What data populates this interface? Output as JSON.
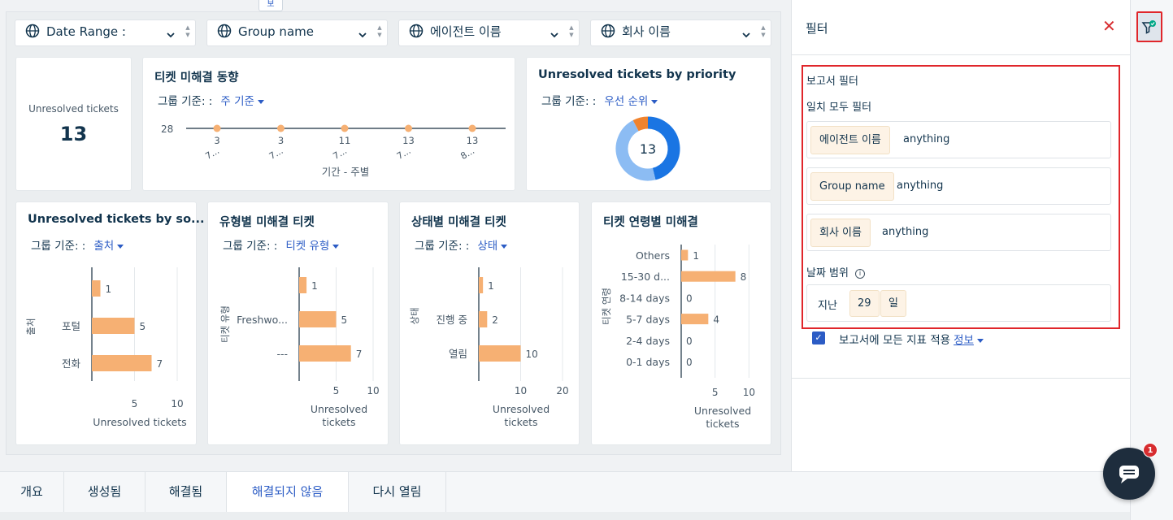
{
  "top_tab": "보",
  "filters": [
    {
      "label": "Date Range :"
    },
    {
      "label": "Group name"
    },
    {
      "label": "에이전트 이름"
    },
    {
      "label": "회사 이름"
    }
  ],
  "cards": {
    "kpi": {
      "label": "Unresolved tickets",
      "value": "13"
    },
    "trend": {
      "title": "티켓 미해결 동향",
      "group_label": "그룹 기준: :",
      "group_value": "주 기준",
      "xlabel": "기간 - 주별"
    },
    "priority": {
      "title": "Unresolved tickets by priority",
      "group_label": "그룹 기준: :",
      "group_value": "우선 순위",
      "center": "13"
    },
    "source": {
      "title": "Unresolved tickets by so...",
      "group_label": "그룹 기준: :",
      "group_value": "출처",
      "ylabel": "출처",
      "xlabel": "Unresolved tickets"
    },
    "type": {
      "title": "유형별 미해결 티켓",
      "group_label": "그룹 기준: :",
      "group_value": "티켓 유형",
      "ylabel": "티켓 유형",
      "xlabel_1": "Unresolved",
      "xlabel_2": "tickets"
    },
    "status": {
      "title": "상태별 미해결 티켓",
      "group_label": "그룹 기준: :",
      "group_value": "상태",
      "ylabel": "상태",
      "xlabel_1": "Unresolved",
      "xlabel_2": "tickets"
    },
    "age": {
      "title": "티켓 연령별 미해결",
      "ylabel": "티켓 연령",
      "xlabel_1": "Unresolved",
      "xlabel_2": "tickets"
    }
  },
  "chart_data": [
    {
      "type": "line",
      "y_tick": "28",
      "x": [
        "7...",
        "7...",
        "7...",
        "7...",
        "8..."
      ],
      "values": [
        3,
        3,
        11,
        13,
        13
      ],
      "xlabel": "기간 - 주별"
    },
    {
      "type": "pie",
      "donut": true,
      "center_label": "13",
      "slices": [
        {
          "value": 6,
          "color": "#1a75e3"
        },
        {
          "value": 6,
          "color": "#8cbcf3"
        },
        {
          "value": 1,
          "color": "#f0832e"
        }
      ]
    },
    {
      "type": "bar",
      "orientation": "horizontal",
      "categories": [
        "",
        "포털",
        "전화"
      ],
      "values": [
        1,
        5,
        7
      ],
      "ylabel": "출처",
      "xlabel": "Unresolved tickets",
      "xticks": [
        5,
        10
      ],
      "xlim": [
        0,
        12
      ]
    },
    {
      "type": "bar",
      "orientation": "horizontal",
      "categories": [
        "",
        "Freshwo...",
        "---"
      ],
      "values": [
        1,
        5,
        7
      ],
      "ylabel": "티켓 유형",
      "xlabel": "Unresolved tickets",
      "xticks": [
        5,
        10
      ],
      "xlim": [
        0,
        10
      ]
    },
    {
      "type": "bar",
      "orientation": "horizontal",
      "categories": [
        "",
        "진행 중",
        "열림"
      ],
      "values": [
        1,
        2,
        10
      ],
      "ylabel": "상태",
      "xlabel": "Unresolved tickets",
      "xticks": [
        10,
        20
      ],
      "xlim": [
        0,
        20
      ]
    },
    {
      "type": "bar",
      "orientation": "horizontal",
      "categories": [
        "Others",
        "15-30 d...",
        "8-14 days",
        "5-7 days",
        "2-4 days",
        "0-1 days"
      ],
      "values": [
        1,
        8,
        0,
        4,
        0,
        0
      ],
      "ylabel": "티켓 연령",
      "xlabel": "Unresolved tickets",
      "xticks": [
        5,
        10
      ],
      "xlim": [
        0,
        12
      ]
    }
  ],
  "filter_panel": {
    "title": "필터",
    "section_title": "보고서 필터",
    "match_label": "일치 모두 필터",
    "conditions": [
      {
        "field": "에이전트 이름",
        "value": "anything"
      },
      {
        "field": "Group name",
        "value": "anything"
      },
      {
        "field": "회사 이름",
        "value": "anything"
      }
    ],
    "date_range": {
      "label": "날짜 범위",
      "prefix": "지난",
      "amount": "29",
      "unit": "일"
    },
    "apply_all_label": "보고서에 모든 지표 적용",
    "info_link": "정보"
  },
  "bottom_tabs": [
    {
      "label": "개요",
      "active": false
    },
    {
      "label": "생성됨",
      "active": false
    },
    {
      "label": "해결됨",
      "active": false
    },
    {
      "label": "해결되지 않음",
      "active": true
    },
    {
      "label": "다시 열림",
      "active": false
    }
  ],
  "chat": {
    "badge": "1"
  },
  "colors": {
    "bar": "#f6b073",
    "accent": "#2c5cc5",
    "highlight": "#e0262b"
  }
}
